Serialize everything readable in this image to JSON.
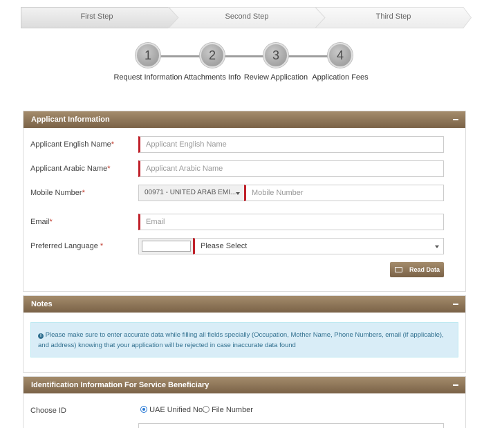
{
  "wizard": {
    "steps": [
      "First Step",
      "Second Step",
      "Third Step"
    ]
  },
  "progress": {
    "items": [
      {
        "number": "1",
        "label": "Request Information"
      },
      {
        "number": "2",
        "label": "Attachments Info"
      },
      {
        "number": "3",
        "label": "Review Application"
      },
      {
        "number": "4",
        "label": "Application Fees"
      }
    ]
  },
  "applicant": {
    "title": "Applicant Information",
    "english_name_label": "Applicant English Name",
    "english_name_placeholder": "Applicant English Name",
    "arabic_name_label": "Applicant Arabic Name",
    "arabic_name_placeholder": "Applicant Arabic Name",
    "mobile_label": "Mobile Number",
    "country_code_value": "00971 - UNITED ARAB EMI...",
    "mobile_placeholder": "Mobile Number",
    "email_label": "Email",
    "email_placeholder": "Email",
    "language_label": "Preferred Language",
    "language_select_value": "Please Select",
    "required_mark": "*",
    "read_data_label": "Read Data"
  },
  "notes": {
    "title": "Notes",
    "text": "Please make sure to enter accurate data while filling all fields specially (Occupation, Mother Name, Phone Numbers, email (if applicable), and address) knowing that your application will be rejected in case inaccurate data found"
  },
  "identification": {
    "title": "Identification Information For Service Beneficiary",
    "choose_id_label": "Choose ID",
    "options": [
      "UAE Unified No.",
      "File Number"
    ],
    "selected": "UAE Unified No."
  },
  "colors": {
    "header_brown": "#8b7355",
    "required_red": "#c0202a",
    "note_bg": "#d9edf7",
    "note_text": "#31708f"
  }
}
